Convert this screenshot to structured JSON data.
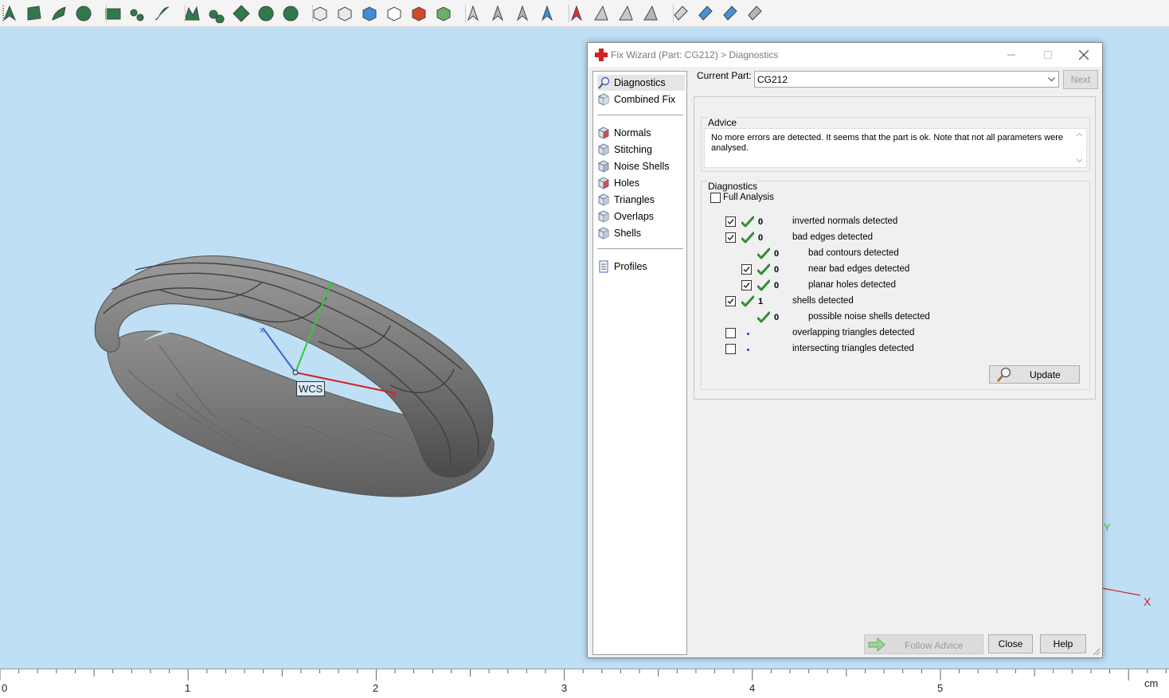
{
  "colors": {
    "viewport_bg": "#bfdff5",
    "toolbar_bg": "#f4f4f4",
    "dialog_bg": "#f0f0f0",
    "check_green": "#2f8f2f",
    "dot_blue": "#1a3fbf",
    "axis_x": "#d22222",
    "axis_y": "#37c837",
    "axis_z": "#3a66cc"
  },
  "toolbar": {
    "icons": [
      "select-arrow-icon",
      "select-surface-icon",
      "select-curve-icon",
      "select-sphere-icon",
      "rect-select-icon",
      "lasso-select-icon",
      "polyline-select-icon",
      "triangle-select-icon",
      "shell-select-icon",
      "flood-select-icon",
      "wheel-select-icon",
      "fan-select-icon",
      "view-box-icon",
      "view-box-front-icon",
      "view-box-shaded-icon",
      "view-box-wire-icon",
      "view-box-red-icon",
      "view-box-green-icon",
      "marker-grey-icon",
      "marker-fill-icon",
      "marker-plus-icon",
      "marker-blue-icon",
      "delete-marker-icon",
      "cone-icon",
      "cone-plus-icon",
      "cone-fill-icon",
      "pick-icon",
      "pick-multi-icon",
      "pick-blue-icon",
      "pick-grey-icon"
    ]
  },
  "viewport": {
    "wcs_label": "WCS",
    "axis_y_label": "Y",
    "axis_x_label": "X"
  },
  "ruler": {
    "ticks": [
      "0",
      "1",
      "2",
      "3",
      "4",
      "5"
    ],
    "unit": "cm"
  },
  "dialog": {
    "title": "Fix Wizard (Part: CG212) > Diagnostics",
    "nav_items": [
      {
        "label": "Diagnostics",
        "icon": "magnifier-icon",
        "selected": true
      },
      {
        "label": "Combined Fix",
        "icon": "combined-fix-icon"
      },
      {
        "label": "Normals",
        "icon": "normals-cube-icon"
      },
      {
        "label": "Stitching",
        "icon": "stitching-cube-icon"
      },
      {
        "label": "Noise Shells",
        "icon": "noise-shells-icon"
      },
      {
        "label": "Holes",
        "icon": "holes-cube-icon"
      },
      {
        "label": "Triangles",
        "icon": "triangles-cube-icon"
      },
      {
        "label": "Overlaps",
        "icon": "overlaps-cube-icon"
      },
      {
        "label": "Shells",
        "icon": "shells-cube-icon"
      },
      {
        "label": "Profiles",
        "icon": "profiles-doc-icon"
      }
    ],
    "current_part_label": "Current Part:",
    "current_part_value": "CG212",
    "next_label": "Next",
    "advice_title": "Advice",
    "advice_text": "No more errors are detected. It seems that the part is ok. Note that not all parameters were analysed.",
    "diagnostics_title": "Diagnostics",
    "full_analysis_label": "Full Analysis",
    "full_analysis_checked": false,
    "rows": [
      {
        "label": "inverted normals detected",
        "count": "0",
        "checked": true,
        "has_checkbox": true,
        "status": "ok"
      },
      {
        "label": "bad edges detected",
        "count": "0",
        "checked": true,
        "has_checkbox": true,
        "status": "ok"
      },
      {
        "label": "bad contours detected",
        "count": "0",
        "has_checkbox": false,
        "status": "ok"
      },
      {
        "label": "near bad edges detected",
        "count": "0",
        "checked": true,
        "has_checkbox": true,
        "status": "ok"
      },
      {
        "label": "planar holes detected",
        "count": "0",
        "checked": true,
        "has_checkbox": true,
        "status": "ok"
      },
      {
        "label": "shells detected",
        "count": "1",
        "checked": true,
        "has_checkbox": true,
        "status": "ok"
      },
      {
        "label": "possible noise shells detected",
        "count": "0",
        "has_checkbox": false,
        "status": "ok"
      },
      {
        "label": "overlapping triangles detected",
        "count": "",
        "checked": false,
        "has_checkbox": true,
        "status": "unknown"
      },
      {
        "label": "intersecting triangles detected",
        "count": "",
        "checked": false,
        "has_checkbox": true,
        "status": "unknown"
      }
    ],
    "update_label": "Update",
    "follow_advice_label": "Follow Advice",
    "close_label": "Close",
    "help_label": "Help"
  }
}
